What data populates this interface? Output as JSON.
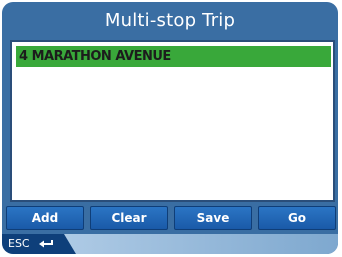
{
  "title": "Multi-stop Trip",
  "list": {
    "items": [
      "4 MARATHON AVENUE"
    ]
  },
  "buttons": {
    "add": "Add",
    "clear": "Clear",
    "save": "Save",
    "go": "Go"
  },
  "footer": {
    "esc_label": "ESC",
    "back_icon": "return-arrow-icon"
  },
  "colors": {
    "background": "#3a6ea3",
    "selected_row": "#39a83a",
    "button": "#1f63b3"
  }
}
